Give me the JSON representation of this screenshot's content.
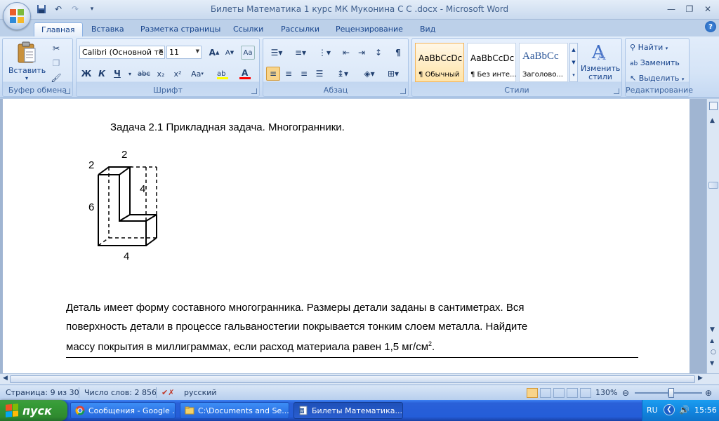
{
  "window": {
    "title": "Билеты Математика 1 курс МК Муконина С С .docx - Microsoft Word"
  },
  "quick_access": {
    "icons": [
      "save-icon",
      "undo-icon",
      "redo-icon",
      "customize-icon"
    ]
  },
  "tabs": [
    {
      "label": "Главная",
      "active": true
    },
    {
      "label": "Вставка"
    },
    {
      "label": "Разметка страницы"
    },
    {
      "label": "Ссылки"
    },
    {
      "label": "Рассылки"
    },
    {
      "label": "Рецензирование"
    },
    {
      "label": "Вид"
    }
  ],
  "ribbon": {
    "clipboard": {
      "label": "Буфер обмена",
      "paste": "Вставить"
    },
    "font": {
      "label": "Шрифт",
      "font_name": "Calibri (Основной те",
      "font_size": "11",
      "bold": "Ж",
      "italic": "К",
      "underline": "Ч",
      "strike": "abc",
      "subscript": "x₂",
      "superscript": "x²",
      "change_case": "Aa",
      "grow": "A",
      "shrink": "A",
      "highlight_color": "#ffff00",
      "font_color": "#ff0000"
    },
    "paragraph": {
      "label": "Абзац"
    },
    "styles": {
      "label": "Стили",
      "items": [
        {
          "sample": "AaBbCcDc",
          "name": "¶ Обычный",
          "selected": true
        },
        {
          "sample": "AaBbCcDc",
          "name": "¶ Без инте..."
        },
        {
          "sample": "AaBbCc",
          "name": "Заголово..."
        }
      ],
      "change_styles": "Изменить стили"
    },
    "editing": {
      "label": "Редактирование",
      "find": "Найти",
      "replace": "Заменить",
      "select": "Выделить"
    }
  },
  "document": {
    "heading": "Задача 2.1   Прикладная задача. Многогранники.",
    "figure_dims": {
      "top": "2",
      "left_top": "2",
      "inner": "4",
      "left": "6",
      "bottom": "4"
    },
    "body_lines": [
      "Деталь имеет форму составного  многогранника. Размеры детали заданы в сантиметрах.  Вся",
      "поверхность детали в процессе гальваностегии покрывается тонким слоем металла. Найдите",
      "массу покрытия в миллиграммах, если расход материала равен 1,5 мг/см"
    ],
    "superscript": "2",
    "period": "."
  },
  "statusbar": {
    "page": "Страница: 9 из 30",
    "words": "Число слов: 2 856",
    "language": "русский",
    "zoom": "130%",
    "zoom_level": 130
  },
  "taskbar": {
    "start": "пуск",
    "items": [
      {
        "label": "Сообщения - Google ..."
      },
      {
        "label": "C:\\Documents and Se..."
      },
      {
        "label": "Билеты Математика...",
        "active": true
      }
    ],
    "lang": "RU",
    "time": "15:56"
  }
}
